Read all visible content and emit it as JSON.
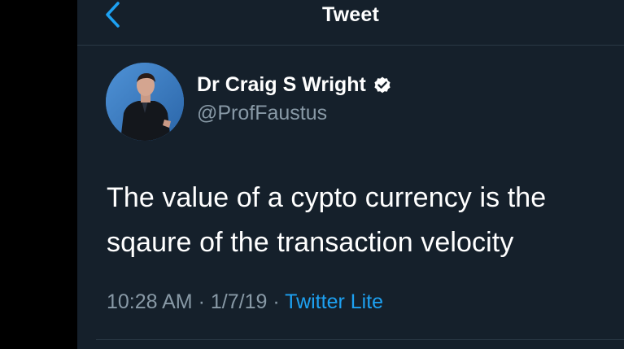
{
  "header": {
    "title": "Tweet",
    "back_icon": "chevron-left-icon"
  },
  "author": {
    "display_name": "Dr Craig S Wright",
    "handle": "@ProfFaustus",
    "verified_icon": "verified-badge-icon"
  },
  "tweet": {
    "text": "The value of a cypto currency is the sqaure of the transaction velocity"
  },
  "meta": {
    "time": "10:28 AM",
    "separator": "·",
    "date": "1/7/19",
    "source": "Twitter Lite"
  },
  "colors": {
    "background": "#15202b",
    "accent": "#1da1f2",
    "secondary_text": "#8899a6"
  }
}
